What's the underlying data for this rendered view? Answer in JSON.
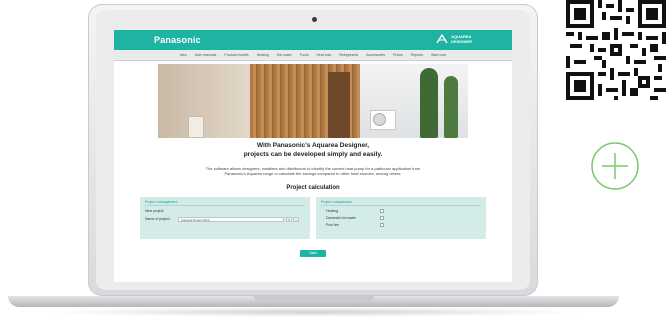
{
  "header": {
    "brand": "Panasonic",
    "logo_line1": "AQUAREA",
    "logo_line2": "DESIGNER"
  },
  "nav": [
    "Intro",
    "User manuals",
    "Product models",
    "Heating",
    "Hot water",
    "Pools",
    "Heat loss",
    "Refrigerants",
    "Accessories",
    "Prices",
    "Reports",
    "Start over"
  ],
  "heading_line1": "With Panasonic's Aquarea Designer,",
  "heading_line2": "projects can be developed simply and easily.",
  "intro_line1": "The software allows designers, installers and distributors to identify the correct heat pump for a particular application from",
  "intro_line2": "Panasonic's Aquarea range or calculate the savings compared to other heat sources, among others.",
  "section_title": "Project calculation",
  "left_panel": {
    "title": "Project management",
    "field1_label": "New project",
    "field2_label": "Name of project",
    "field2_value": "Aquarea Project (EN)"
  },
  "right_panel": {
    "title": "Project components",
    "items": [
      "Heating",
      "Domestic hot water",
      "Pool fee"
    ]
  },
  "start_label": "Start",
  "colors": {
    "accent": "#1fb3a3",
    "panel": "#d3ece8",
    "plus": "#7bc96f"
  },
  "icons": [
    "qr-code-icon",
    "plus-circle-icon",
    "aquarea-logo-icon"
  ]
}
